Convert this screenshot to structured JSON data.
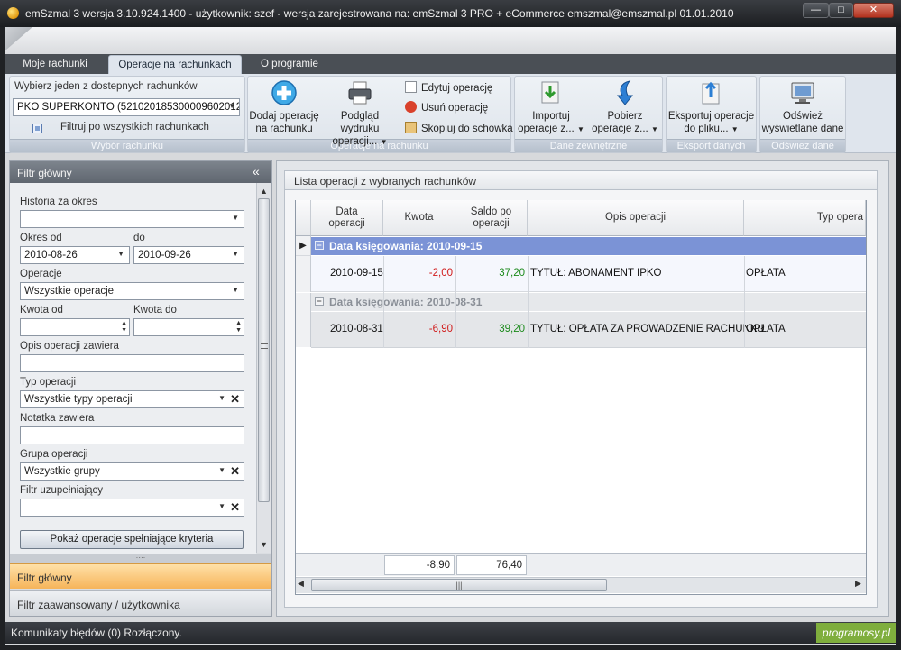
{
  "window": {
    "title": "emSzmal 3 wersja 3.10.924.1400 - użytkownik: szef - wersja zarejestrowana na: emSzmal 3 PRO + eCommerce emszmal@emszmal.pl 01.01.2010",
    "min": "—",
    "max": "□",
    "close": "✕"
  },
  "tabs": [
    {
      "label": "Moje rachunki",
      "active": false
    },
    {
      "label": "Operacje na rachunkach",
      "active": true
    },
    {
      "label": "O programie",
      "active": false
    }
  ],
  "ribbon": {
    "account_group": {
      "prompt": "Wybierz jeden z dostepnych rachunków",
      "selected_account": "PKO SUPERKONTO (5210201853000096020129...",
      "filter_all_label": "Filtruj po wszystkich rachunkach",
      "group_label": "Wybór rachunku"
    },
    "operations_group": {
      "add_label_1": "Dodaj operację",
      "add_label_2": "na rachunku",
      "preview_label_1": "Podgląd wydruku",
      "preview_label_2": "operacji...",
      "edit_label": "Edytuj operację",
      "delete_label": "Usuń operację",
      "copy_label": "Skopiuj do schowka",
      "group_label": "Operacje na rachunku"
    },
    "external_group": {
      "import_label_1": "Importuj",
      "import_label_2": "operacje z...",
      "fetch_label_1": "Pobierz",
      "fetch_label_2": "operacje z...",
      "group_label": "Dane zewnętrzne"
    },
    "export_group": {
      "export_label_1": "Eksportuj operacje",
      "export_label_2": "do pliku...",
      "group_label": "Eksport danych"
    },
    "refresh_group": {
      "refresh_label_1": "Odśwież",
      "refresh_label_2": "wyświetlane dane",
      "group_label": "Odśwież dane"
    }
  },
  "filter": {
    "header": "Filtr główny",
    "collapse": "«",
    "history_label": "Historia za okres",
    "history_value": "",
    "period_from_label": "Okres od",
    "period_to_label": "do",
    "period_from": "2010-08-26",
    "period_to": "2010-09-26",
    "operations_label": "Operacje",
    "operations_value": "Wszystkie operacje",
    "amount_from_label": "Kwota od",
    "amount_to_label": "Kwota do",
    "description_label": "Opis operacji zawiera",
    "type_label": "Typ operacji",
    "type_value": "Wszystkie typy operacji",
    "note_label": "Notatka zawiera",
    "group_label": "Grupa operacji",
    "group_value": "Wszystkie grupy",
    "extra_label": "Filtr uzupełniający",
    "extra_value": "",
    "show_button": "Pokaż operacje spełniające kryteria",
    "nav_main": "Filtr główny",
    "nav_advanced": "Filtr zaawansowany / użytkownika"
  },
  "list": {
    "header": "Lista operacji z wybranych rachunków",
    "columns": {
      "date": "Data\noperacji",
      "amount": "Kwota",
      "balance": "Saldo po\noperacji",
      "description": "Opis operacji",
      "type": "Typ opera"
    },
    "groups": [
      {
        "label": "Data księgowania: 2010-09-15",
        "rows": [
          {
            "date": "2010-09-15",
            "amount": "-2,00",
            "balance": "37,20",
            "description": "TYTUŁ: ABONAMENT IPKO",
            "type": "OPŁATA"
          }
        ]
      },
      {
        "label": "Data księgowania: 2010-08-31",
        "rows": [
          {
            "date": "2010-08-31",
            "amount": "-6,90",
            "balance": "39,20",
            "description": "TYTUŁ: OPŁATA ZA PROWADZENIE RACHUNKU",
            "type": "OPŁATA"
          }
        ]
      }
    ],
    "totals": {
      "amount": "-8,90",
      "balance": "76,40"
    }
  },
  "status": {
    "text": "Komunikaty błędów (0)  Rozłączony.",
    "watermark": "programosy.pl"
  },
  "colors": {
    "negative": "#d01818",
    "positive": "#1b8a1b",
    "group_selected": "#7b93d6"
  }
}
